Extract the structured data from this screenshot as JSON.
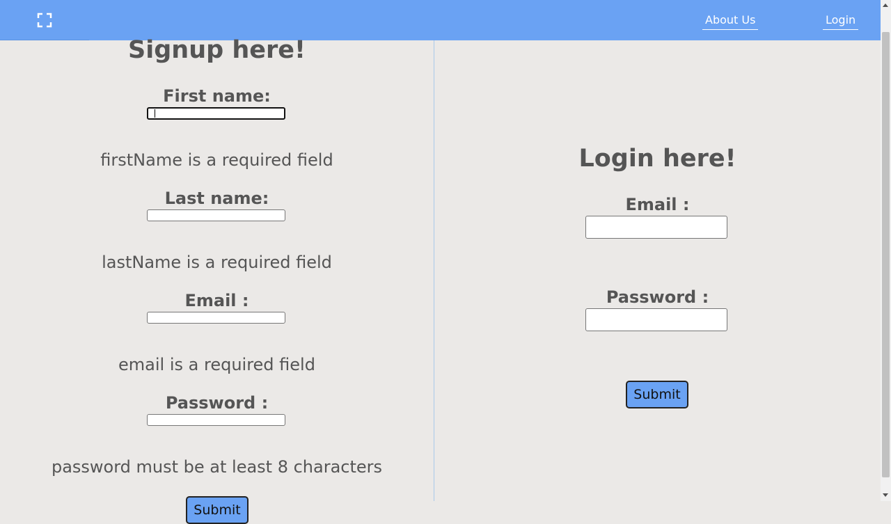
{
  "navbar": {
    "expand_icon": "fullscreen-expand-icon",
    "about_label": "About Us",
    "login_label": "Login",
    "background_color": "#6aa2f3"
  },
  "signup": {
    "title": "Signup here!",
    "fields": [
      {
        "label": "First name:",
        "error": "firstName is a required field",
        "value": ""
      },
      {
        "label": "Last name:",
        "error": "lastName is a required field",
        "value": ""
      },
      {
        "label": "Email :",
        "error": "email is a required field",
        "value": ""
      },
      {
        "label": "Password :",
        "error": "password must be at least 8 characters",
        "value": ""
      }
    ],
    "submit_label": "Submit"
  },
  "login": {
    "title": "Login here!",
    "email_label": "Email :",
    "email_value": "",
    "password_label": "Password :",
    "password_value": "",
    "submit_label": "Submit"
  }
}
